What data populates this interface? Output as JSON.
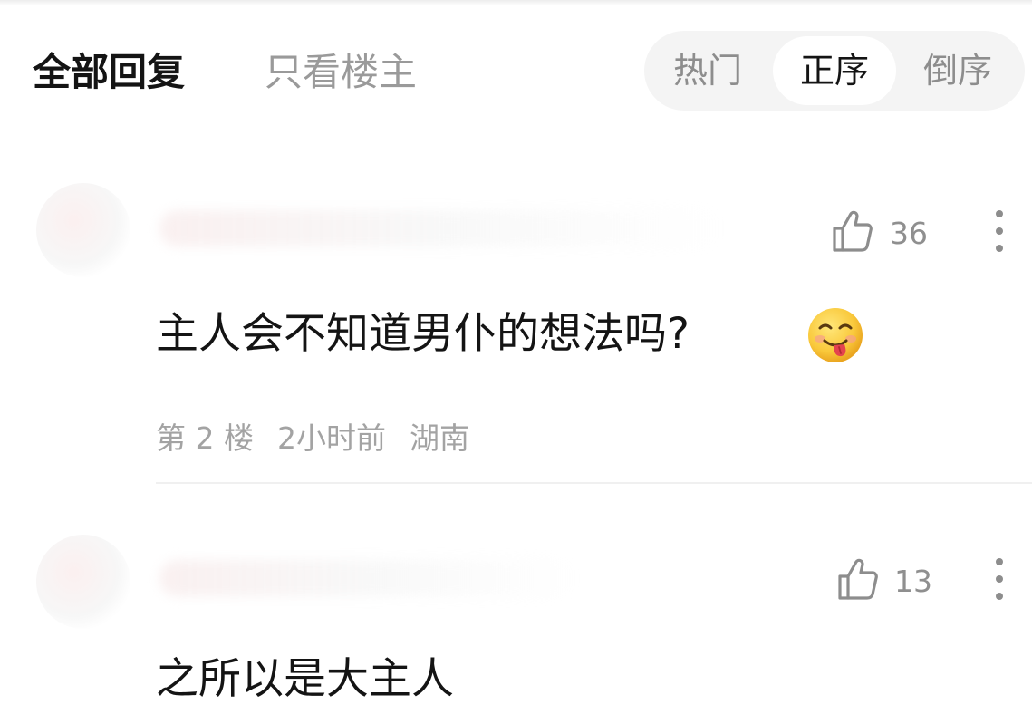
{
  "header": {
    "filter_all": "全部回复",
    "filter_op_only": "只看楼主",
    "sort_options": [
      "热门",
      "正序",
      "倒序"
    ],
    "sort_selected": "正序"
  },
  "comments": [
    {
      "username": "",
      "likes": "36",
      "text": "主人会不知道男仆的想法吗?",
      "emoji": "grinning-tongue-emoji",
      "floor": "第 2 楼",
      "time": "2小时前",
      "location": "湖南"
    },
    {
      "username": "",
      "likes": "13",
      "text": "之所以是大主人"
    }
  ],
  "colors": {
    "text_primary": "#141414",
    "text_secondary": "#9a9a9a",
    "meta": "#a3a3a3",
    "pill_bg": "#f4f4f4",
    "pill_selected_bg": "#ffffff"
  },
  "icons": {
    "like": "thumbs-up-icon",
    "more": "more-vertical-icon"
  }
}
